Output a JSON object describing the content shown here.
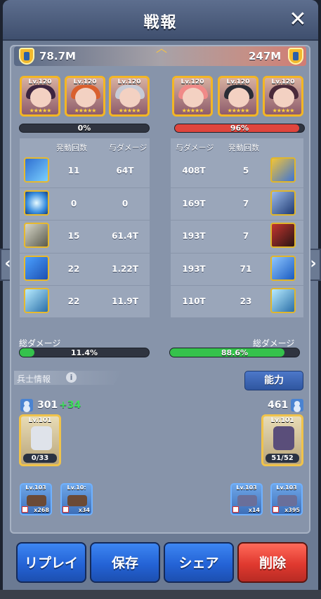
{
  "window": {
    "title": "戦報",
    "close_symbol": "✕"
  },
  "score": {
    "left": "78.7M",
    "right": "247M"
  },
  "heroes": {
    "left": [
      {
        "lv": "Lv.120"
      },
      {
        "lv": "Lv.120"
      },
      {
        "lv": "Lv.120"
      }
    ],
    "right": [
      {
        "lv": "Lv.120"
      },
      {
        "lv": "Lv.120"
      },
      {
        "lv": "Lv.120"
      }
    ]
  },
  "hp": {
    "left": {
      "label": "0%",
      "value": 0
    },
    "right": {
      "label": "96%",
      "value": 96
    }
  },
  "stats": {
    "left_headers": {
      "count": "発動回数",
      "damage": "与ダメージ"
    },
    "right_headers": {
      "damage": "与ダメージ",
      "count": "発動回数"
    },
    "left_rows": [
      {
        "count": "11",
        "damage": "64T"
      },
      {
        "count": "0",
        "damage": "0"
      },
      {
        "count": "15",
        "damage": "61.4T"
      },
      {
        "count": "22",
        "damage": "1.22T"
      },
      {
        "count": "22",
        "damage": "11.9T"
      }
    ],
    "right_rows": [
      {
        "damage": "408T",
        "count": "5"
      },
      {
        "damage": "169T",
        "count": "7"
      },
      {
        "damage": "193T",
        "count": "7"
      },
      {
        "damage": "193T",
        "count": "71"
      },
      {
        "damage": "110T",
        "count": "23"
      }
    ]
  },
  "total": {
    "label": "総ダメージ",
    "left": {
      "label": "11.4%",
      "value": 11.4
    },
    "right": {
      "label": "88.6%",
      "value": 88.6
    }
  },
  "troops": {
    "section_label": "兵士情報",
    "ability_button": "能力",
    "left_count": "301",
    "left_bonus": "+34",
    "right_count": "461",
    "left_unit": {
      "lv": "Lv.101",
      "count": "0/33"
    },
    "right_unit": {
      "lv": "Lv.101",
      "count": "51/52"
    },
    "left_tanks": [
      {
        "lv": "Lv.103",
        "qty": "x268"
      },
      {
        "lv": "Lv.10:",
        "qty": "x34"
      }
    ],
    "right_tanks": [
      {
        "lv": "Lv.103",
        "qty": "x14"
      },
      {
        "lv": "Lv.103",
        "qty": "x395"
      }
    ]
  },
  "buttons": {
    "replay": "リプレイ",
    "save": "保存",
    "share": "シェア",
    "delete": "削除"
  },
  "colors": {
    "hp_red": "#e0453d",
    "total_green": "#35c24c",
    "gold": "#f3b624",
    "button_blue": "#2463d6",
    "button_red": "#e0392f"
  },
  "icons": {
    "close": "close-icon",
    "shield": "shield-icon",
    "info": "info-icon",
    "person": "person-icon",
    "nav_left": "chevron-left-icon",
    "nav_right": "chevron-right-icon"
  }
}
